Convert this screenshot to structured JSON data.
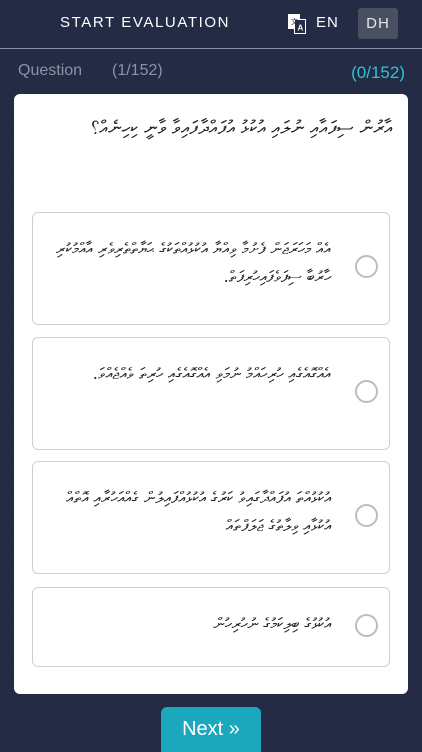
{
  "header": {
    "title": "START EVALUATION",
    "language_icon": "translate-icon",
    "lang_en": "EN",
    "lang_dh": "DH"
  },
  "progress": {
    "label": "Question",
    "index": "(1/152)",
    "score": "(0/152)",
    "score_color": "#2fc4cf"
  },
  "question": {
    "text": "އާރުން ސިފައާއި ނުލައި އުކުޅު އުފައްދާފައިވާ ވާނީ ކިހިނެއް؟"
  },
  "options": [
    {
      "text": "އެއް މަހަރަޖަން ފެށުމާ ވިއްޔާ އުކުޅުއްތަކުގެ ޙަޔާތްތެރިވެރި އާއްމުކުރި ހާރުބާ ސިފަވެފައިހުރިފަތް.",
      "radio": "radio-unchecked-icon"
    },
    {
      "text": "އެއްގޮއެގެއި ހުރިހައްމު ނުމަވި އެއްގޮއެގެއި ހުރިތަ ވެއްޖެއްވަ.",
      "radio": "radio-unchecked-icon"
    },
    {
      "text": "އުކުޅުއްތަ އުފައްދާގައިވު ކަރުގެ އުކުޅުއްފައިލުން ގެއްއަހުރާއި އޮތްއް އުކުޅާއި ވިލާތުގެ ޖަލަފްތައް",
      "radio": "radio-unchecked-icon"
    },
    {
      "text": "އުކުޅުގެ ބިލިކަމުގެ ނުހުރިހުން",
      "radio": "radio-unchecked-icon"
    }
  ],
  "footer": {
    "next_label": "Next »"
  }
}
